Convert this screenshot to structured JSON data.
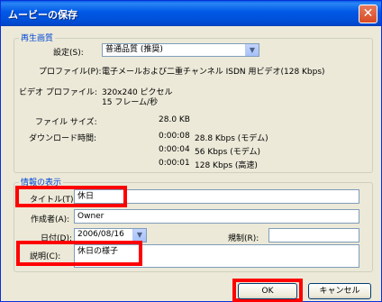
{
  "window": {
    "title": "ムービーの保存",
    "close_label": "✕"
  },
  "playback": {
    "group_label": "再生画質",
    "setting_label": "設定(S):",
    "setting_value": "普通品質 (推奨)",
    "profile_label": "プロファイル(P):",
    "profile_value": "電子メールおよび二重チャンネル ISDN 用ビデオ(128 Kbps)",
    "video_profile_label": "ビデオ プロファイル:",
    "video_profile_line1": "320x240 ピクセル",
    "video_profile_line2": "15 フレーム/秒",
    "file_size_label": "ファイル サイズ:",
    "file_size_value": "28.0 KB",
    "download_label": "ダウンロード時間:",
    "download_rows": [
      {
        "time": "0:00:08",
        "speed": "28.8 Kbps (モデム)"
      },
      {
        "time": "0:00:04",
        "speed": "56 Kbps (モデム)"
      },
      {
        "time": "0:00:01",
        "speed": "128 Kbps (高速)"
      }
    ]
  },
  "info": {
    "group_label": "情報の表示",
    "title_label": "タイトル(T):",
    "title_value": "休日",
    "author_label": "作成者(A):",
    "author_value": "Owner",
    "date_label": "日付(D):",
    "date_value": "2006/08/16",
    "rating_label": "規制(R):",
    "rating_value": "",
    "description_label": "説明(C):",
    "description_value": "休日の様子"
  },
  "buttons": {
    "ok": "OK",
    "cancel": "キャンセル"
  },
  "colors": {
    "title_bar": "#0058e6",
    "highlight": "#ff0000",
    "group_title": "#0046d5"
  }
}
